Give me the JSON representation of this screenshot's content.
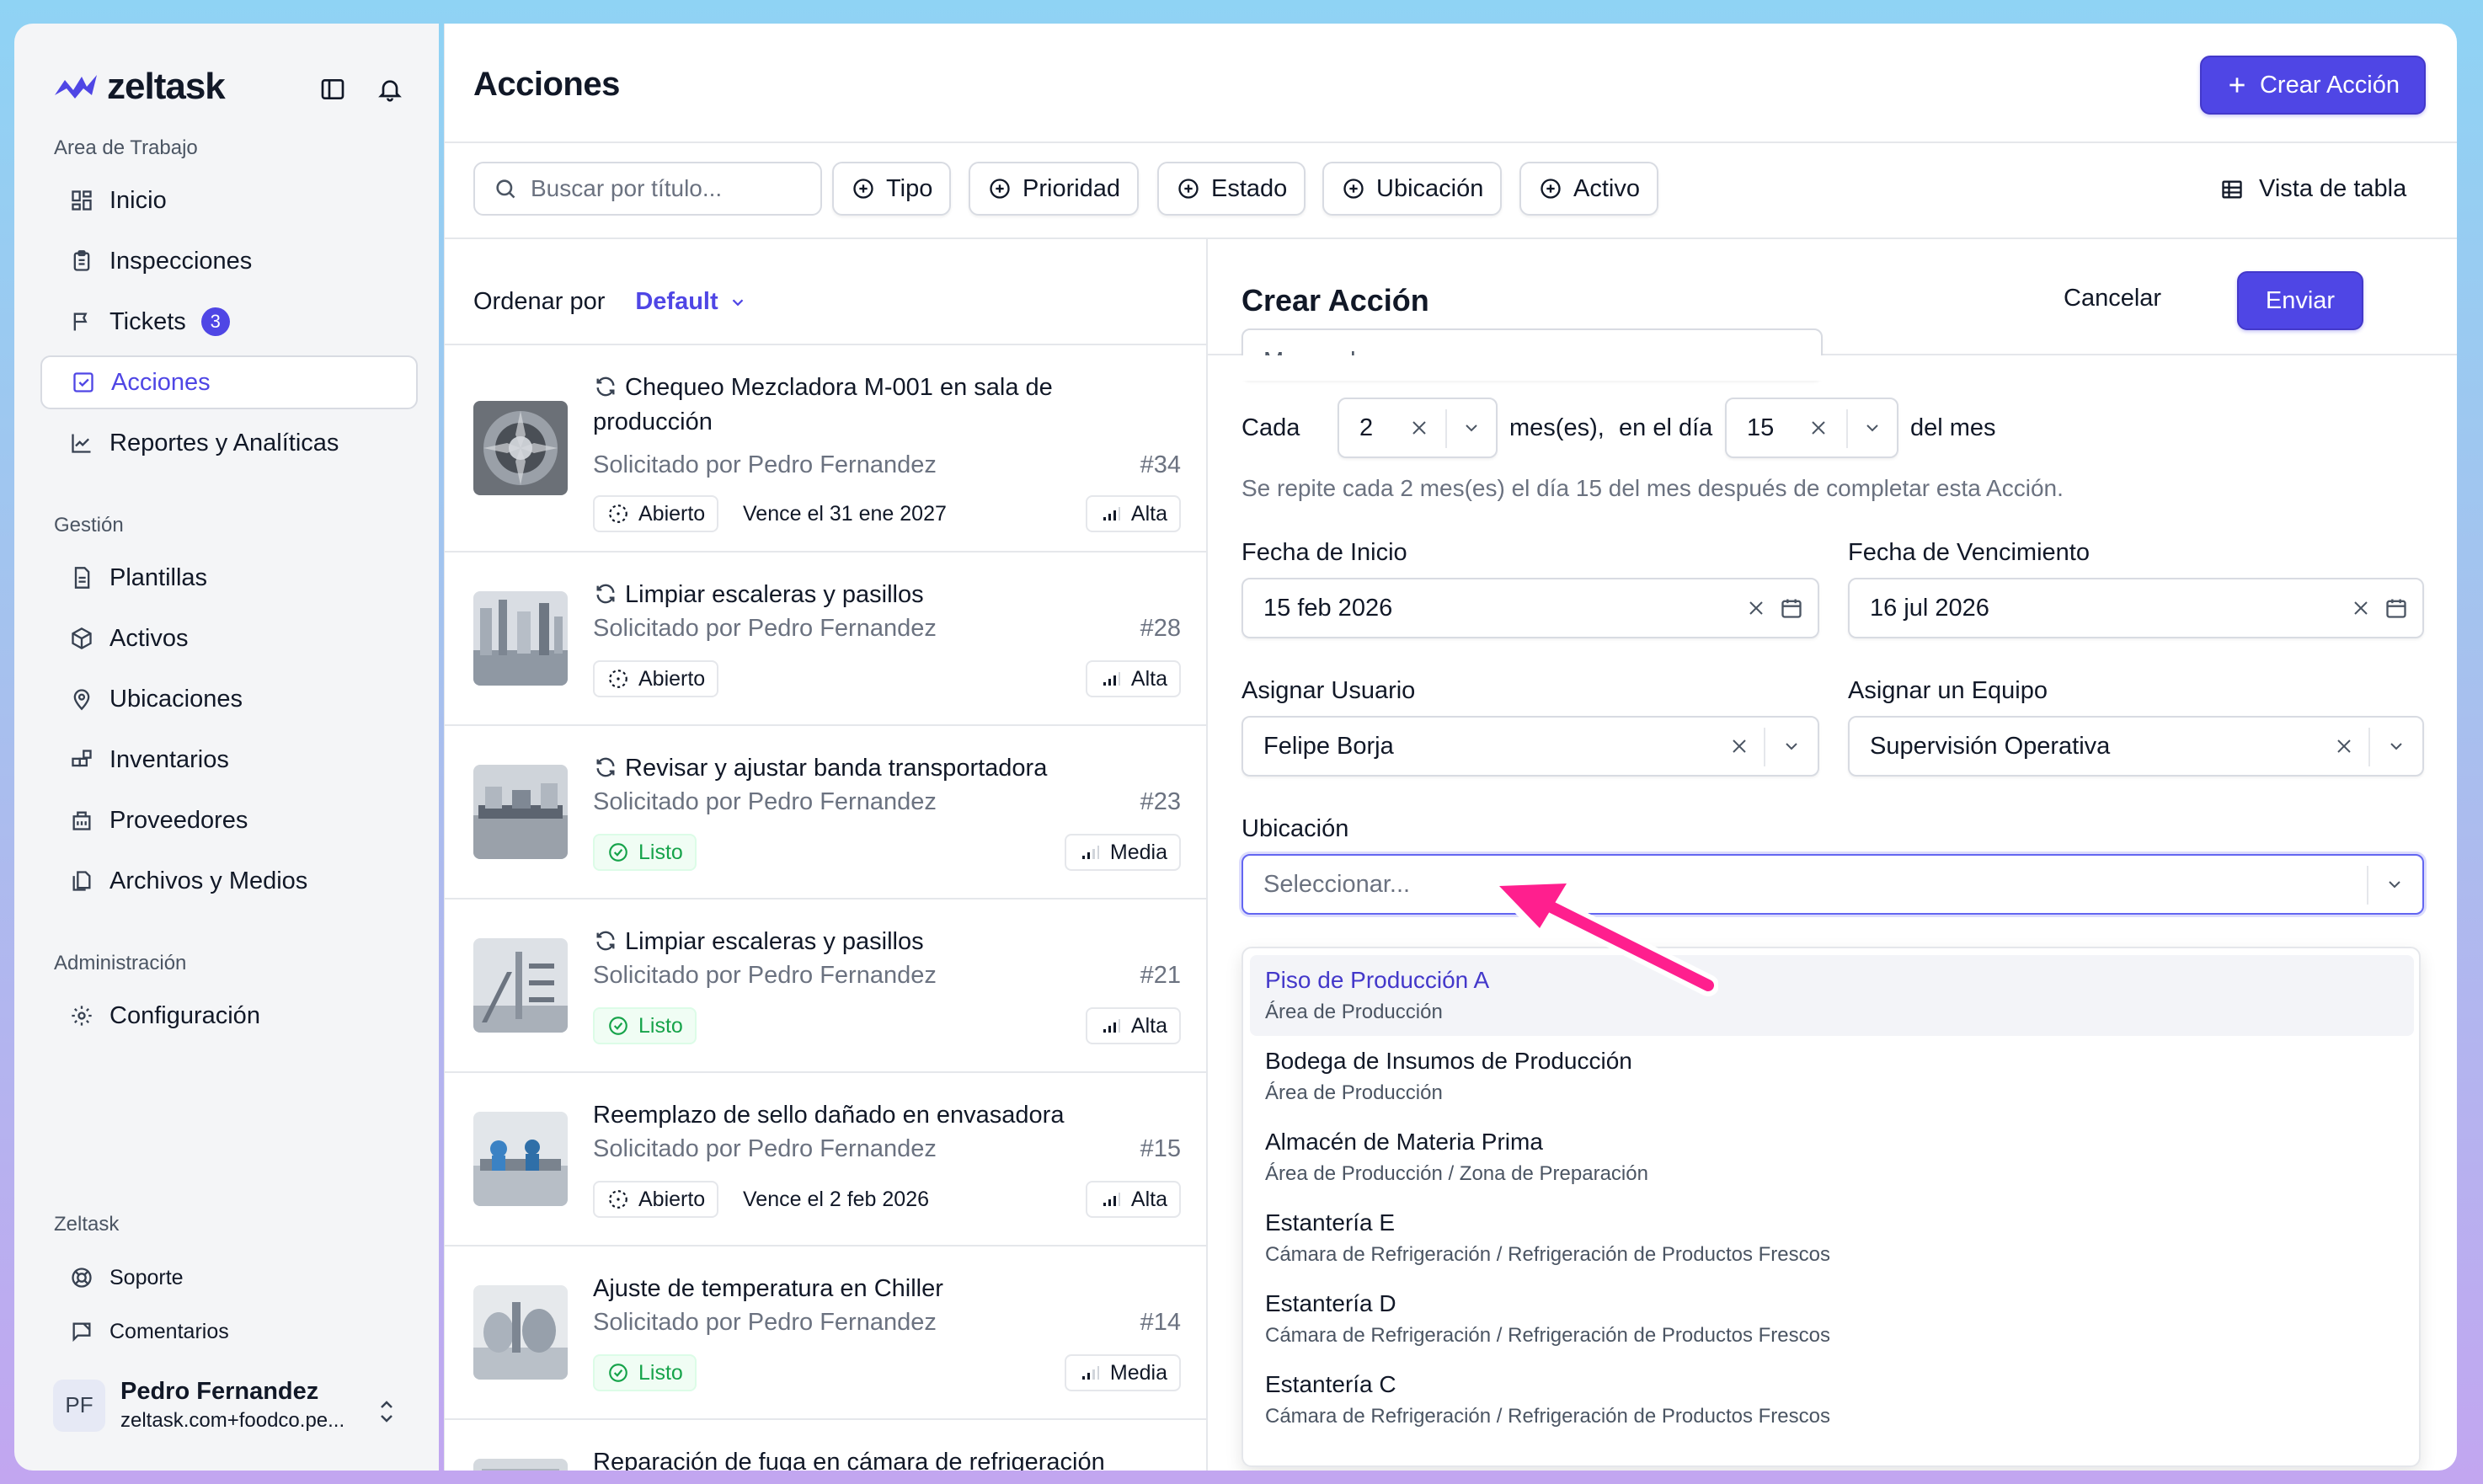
{
  "brand": {
    "name": "zeltask"
  },
  "sidebar": {
    "workspace_label": "Area de Trabajo",
    "workspace_items": [
      {
        "label": "Inicio",
        "icon": "grid-icon"
      },
      {
        "label": "Inspecciones",
        "icon": "clipboard-icon"
      },
      {
        "label": "Tickets",
        "icon": "flag-icon",
        "badge": "3"
      },
      {
        "label": "Acciones",
        "icon": "checkbox-icon",
        "active": true
      },
      {
        "label": "Reportes y Analíticas",
        "icon": "chart-line-icon"
      }
    ],
    "management_label": "Gestión",
    "management_items": [
      {
        "label": "Plantillas",
        "icon": "document-icon"
      },
      {
        "label": "Activos",
        "icon": "cube-icon"
      },
      {
        "label": "Ubicaciones",
        "icon": "location-pin-icon"
      },
      {
        "label": "Inventarios",
        "icon": "blocks-icon"
      },
      {
        "label": "Proveedores",
        "icon": "building-icon"
      },
      {
        "label": "Archivos y Medios",
        "icon": "files-icon"
      }
    ],
    "admin_label": "Administración",
    "admin_items": [
      {
        "label": "Configuración",
        "icon": "gear-icon"
      }
    ],
    "footer_label": "Zeltask",
    "footer_items": [
      {
        "label": "Soporte",
        "icon": "lifebuoy-icon"
      },
      {
        "label": "Comentarios",
        "icon": "feedback-icon"
      }
    ],
    "user": {
      "initials": "PF",
      "name": "Pedro Fernandez",
      "email": "zeltask.com+foodco.pe..."
    }
  },
  "header": {
    "title": "Acciones",
    "create_button": "Crear Acción"
  },
  "toolbar": {
    "search_placeholder": "Buscar por título...",
    "filters": [
      "Tipo",
      "Prioridad",
      "Estado",
      "Ubicación",
      "Activo"
    ],
    "view_label": "Vista de tabla"
  },
  "list": {
    "sort_label": "Ordenar por",
    "sort_value": "Default",
    "items": [
      {
        "title": "Chequeo Mezcladora M-001 en sala de producción",
        "requested": "Solicitado por Pedro Fernandez",
        "number": "#34",
        "status": "Abierto",
        "due": "Vence el 31 ene 2027",
        "priority": "Alta",
        "recurring": true
      },
      {
        "title": "Limpiar escaleras y pasillos",
        "requested": "Solicitado por Pedro Fernandez",
        "number": "#28",
        "status": "Abierto",
        "due": "",
        "priority": "Alta",
        "recurring": true
      },
      {
        "title": "Revisar y ajustar banda transportadora",
        "requested": "Solicitado por Pedro Fernandez",
        "number": "#23",
        "status": "Listo",
        "due": "",
        "priority": "Media",
        "recurring": true
      },
      {
        "title": "Limpiar escaleras y pasillos",
        "requested": "Solicitado por Pedro Fernandez",
        "number": "#21",
        "status": "Listo",
        "due": "",
        "priority": "Alta",
        "recurring": true
      },
      {
        "title": "Reemplazo de sello dañado en envasadora",
        "requested": "Solicitado por Pedro Fernandez",
        "number": "#15",
        "status": "Abierto",
        "due": "Vence el 2 feb 2026",
        "priority": "Alta",
        "recurring": false
      },
      {
        "title": "Ajuste de temperatura en Chiller",
        "requested": "Solicitado por Pedro Fernandez",
        "number": "#14",
        "status": "Listo",
        "due": "",
        "priority": "Media",
        "recurring": false
      },
      {
        "title": "Reparación de fuga en cámara de refrigeración",
        "requested": "",
        "number": "",
        "status": "",
        "due": "",
        "priority": "",
        "recurring": false
      }
    ]
  },
  "form": {
    "title": "Crear Acción",
    "cancel_label": "Cancelar",
    "submit_label": "Enviar",
    "frequency_value": "Mensual",
    "repeat": {
      "prefix": "Cada",
      "interval": "2",
      "unit": "mes(es),",
      "day_prefix": "en el día",
      "day": "15",
      "suffix": "del mes",
      "hint": "Se repite cada 2 mes(es) el día 15 del mes después de completar esta Acción."
    },
    "start_label": "Fecha de Inicio",
    "start_value": "15 feb 2026",
    "due_label": "Fecha de Vencimiento",
    "due_value": "16 jul 2026",
    "user_label": "Asignar Usuario",
    "user_value": "Felipe Borja",
    "team_label": "Asignar un Equipo",
    "team_value": "Supervisión Operativa",
    "location_label": "Ubicación",
    "location_placeholder": "Seleccionar...",
    "location_options": [
      {
        "name": "Piso de Producción A",
        "path": "Área de Producción",
        "highlighted": true
      },
      {
        "name": "Bodega de Insumos de Producción",
        "path": "Área de Producción"
      },
      {
        "name": "Almacén de Materia Prima",
        "path": "Área de Producción / Zona de Preparación"
      },
      {
        "name": "Estantería E",
        "path": "Cámara de Refrigeración / Refrigeración de Productos Frescos"
      },
      {
        "name": "Estantería D",
        "path": "Cámara de Refrigeración / Refrigeración de Productos Frescos"
      },
      {
        "name": "Estantería C",
        "path": "Cámara de Refrigeración / Refrigeración de Productos Frescos"
      }
    ]
  },
  "colors": {
    "accent": "#4f46e5",
    "annotation_arrow": "#ff1f8e",
    "success": "#16a34a"
  }
}
